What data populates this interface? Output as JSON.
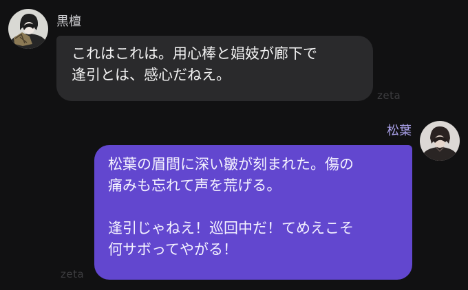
{
  "messages": [
    {
      "sender": "黒檀",
      "text": "これはこれは。用心棒と娼妓が廊下で\n逢引とは、感心だねえ。",
      "watermark": "zeta"
    },
    {
      "sender": "松葉",
      "text": "松葉の眉間に深い皺が刻まれた。傷の\n痛みも忘れて声を荒げる。\n\n逢引じゃねえ！巡回中だ！てめえこそ\n何サボってやがる！",
      "watermark": "zeta"
    }
  ],
  "colors": {
    "background": "#111112",
    "left_bubble": "#2a2a2c",
    "right_bubble": "#6247cf",
    "right_sender": "#a9a0e8"
  },
  "icons": {
    "left_avatar": "character-avatar-icon",
    "right_avatar": "character-avatar-icon"
  }
}
